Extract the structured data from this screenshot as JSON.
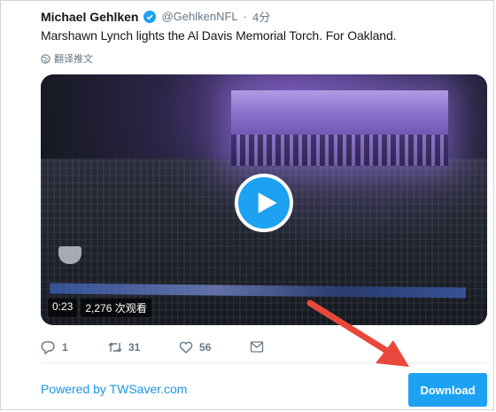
{
  "tweet": {
    "author_name": "Michael Gehlken",
    "handle": "@GehlkenNFL",
    "separator": "·",
    "time": "4分",
    "text": "Marshawn Lynch lights the Al Davis Memorial Torch. For Oakland.",
    "translate_label": "翻译推文"
  },
  "video": {
    "duration": "0:23",
    "views": "2,276 次观看"
  },
  "actions": {
    "reply_count": "1",
    "retweet_count": "31",
    "like_count": "56"
  },
  "footer": {
    "powered_by": "Powered by TWSaver.com",
    "download_label": "Download"
  },
  "colors": {
    "accent": "#1da1f2",
    "link": "#1b95e0",
    "annotation_arrow": "#e8483b"
  },
  "icons": [
    "verified-icon",
    "globe-icon",
    "play-icon",
    "reply-icon",
    "retweet-icon",
    "like-icon",
    "share-icon"
  ]
}
